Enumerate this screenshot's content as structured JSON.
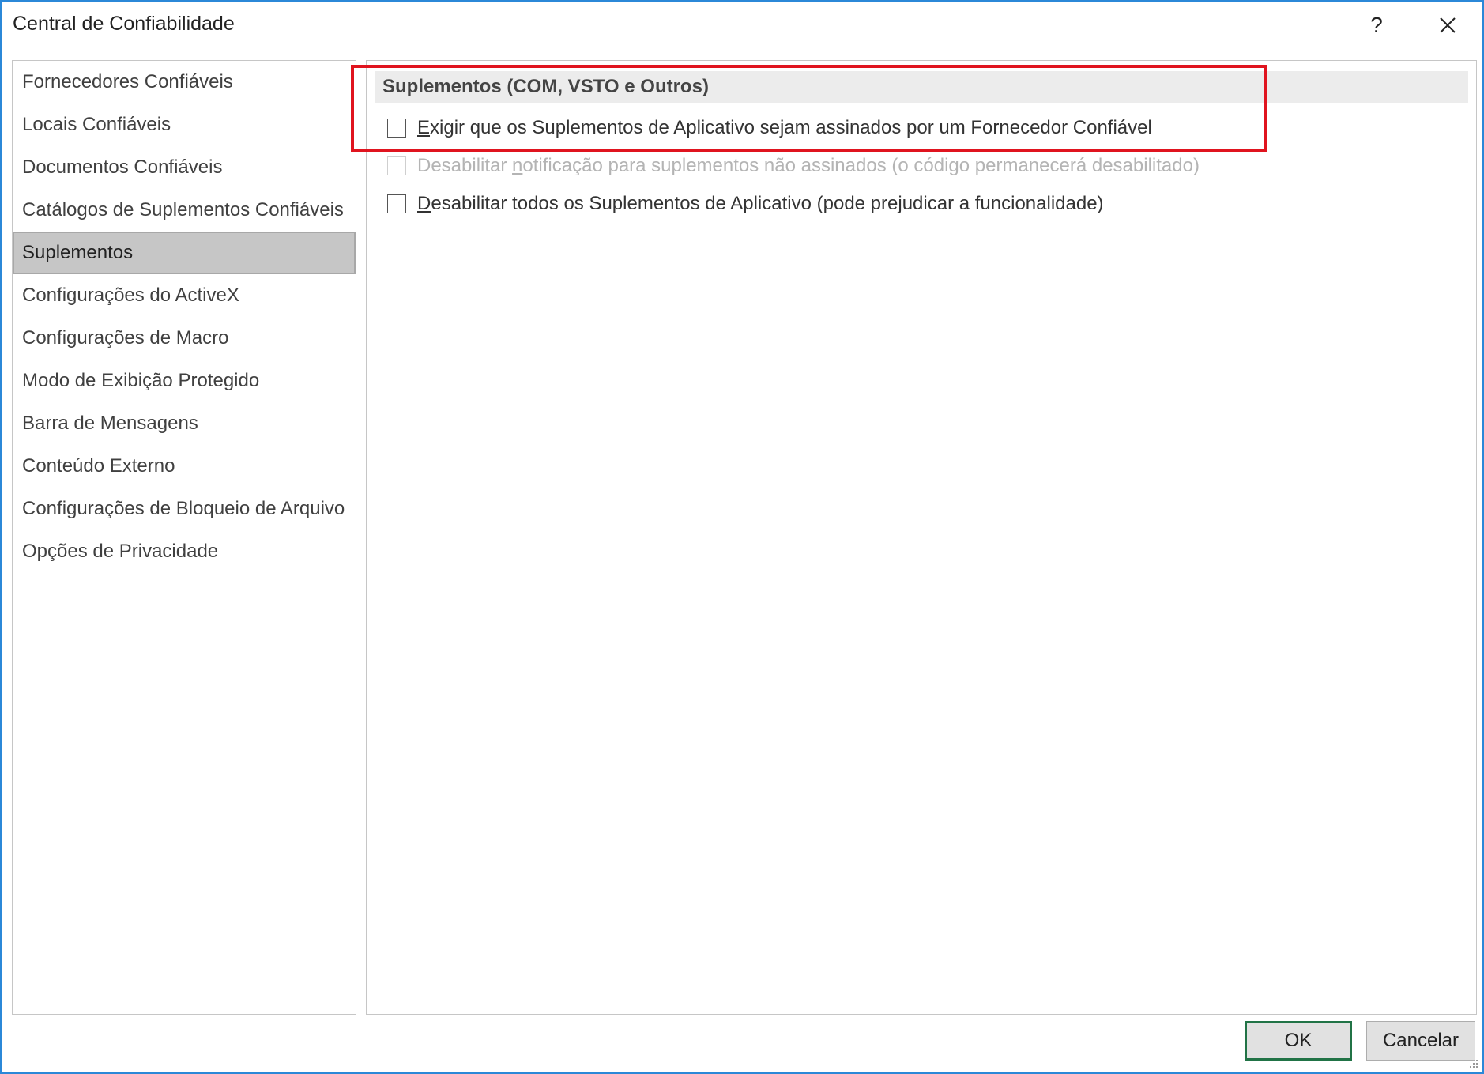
{
  "window": {
    "title": "Central de Confiabilidade",
    "help_label": "?",
    "close_icon": "close-icon",
    "border_color": "#2b88d8"
  },
  "sidebar": {
    "items": [
      {
        "label": "Fornecedores Confiáveis",
        "selected": false
      },
      {
        "label": "Locais Confiáveis",
        "selected": false
      },
      {
        "label": "Documentos Confiáveis",
        "selected": false
      },
      {
        "label": "Catálogos de Suplementos Confiáveis",
        "selected": false
      },
      {
        "label": "Suplementos",
        "selected": true
      },
      {
        "label": "Configurações do ActiveX",
        "selected": false
      },
      {
        "label": "Configurações de Macro",
        "selected": false
      },
      {
        "label": "Modo de Exibição Protegido",
        "selected": false
      },
      {
        "label": "Barra de Mensagens",
        "selected": false
      },
      {
        "label": "Conteúdo Externo",
        "selected": false
      },
      {
        "label": "Configurações de Bloqueio de Arquivo",
        "selected": false
      },
      {
        "label": "Opções de Privacidade",
        "selected": false
      }
    ]
  },
  "main": {
    "section_title": "Suplementos (COM, VSTO e Outros)",
    "options": [
      {
        "accel": "E",
        "rest": "xigir que os Suplementos de Aplicativo sejam assinados por um Fornecedor Confiável",
        "checked": false,
        "enabled": true
      },
      {
        "pre": "Desabilitar ",
        "accel": "n",
        "rest": "otificação para suplementos não assinados (o código permanecerá desabilitado)",
        "checked": false,
        "enabled": false
      },
      {
        "accel": "D",
        "rest": "esabilitar todos os Suplementos de Aplicativo (pode prejudicar a funcionalidade)",
        "checked": false,
        "enabled": true
      }
    ],
    "highlight_color": "#e0141f"
  },
  "footer": {
    "ok_label": "OK",
    "cancel_label": "Cancelar",
    "ok_border_color": "#217346"
  }
}
